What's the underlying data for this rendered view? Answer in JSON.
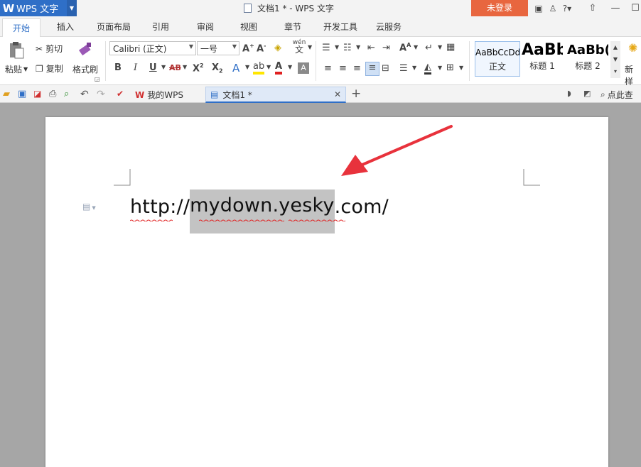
{
  "titlebar": {
    "app_name": "WPS 文字",
    "window_title": "文档1 * - WPS 文字",
    "login_label": "未登录",
    "help_label": "?"
  },
  "tabs": [
    "开始",
    "插入",
    "页面布局",
    "引用",
    "审阅",
    "视图",
    "章节",
    "开发工具",
    "云服务"
  ],
  "ribbon": {
    "paste": "粘贴",
    "cut": "剪切",
    "copy": "复制",
    "format_painter": "格式刷",
    "font_name": "Calibri (正文)",
    "font_size": "一号",
    "styles": [
      {
        "sample": "AaBbCcDd",
        "label": "正文"
      },
      {
        "sample": "AaBb",
        "label": "标题 1"
      },
      {
        "sample": "AaBb(",
        "label": "标题 2"
      }
    ],
    "new_style": "新样",
    "pinyin_top": "wén",
    "pinyin_bottom": "文"
  },
  "quickbar": {
    "doc_tabs": [
      {
        "label": "我的WPS"
      },
      {
        "label": "文档1 *"
      }
    ],
    "search_label": "点此查"
  },
  "document": {
    "url_prefix": "http://",
    "url_selected": "mydown.yesky",
    "url_suffix": ".com/"
  },
  "colors": {
    "brand_blue": "#2f6fc7",
    "login_orange": "#e8663f",
    "selection_gray": "#c3c3c3",
    "arrow_red": "#e8323c"
  }
}
